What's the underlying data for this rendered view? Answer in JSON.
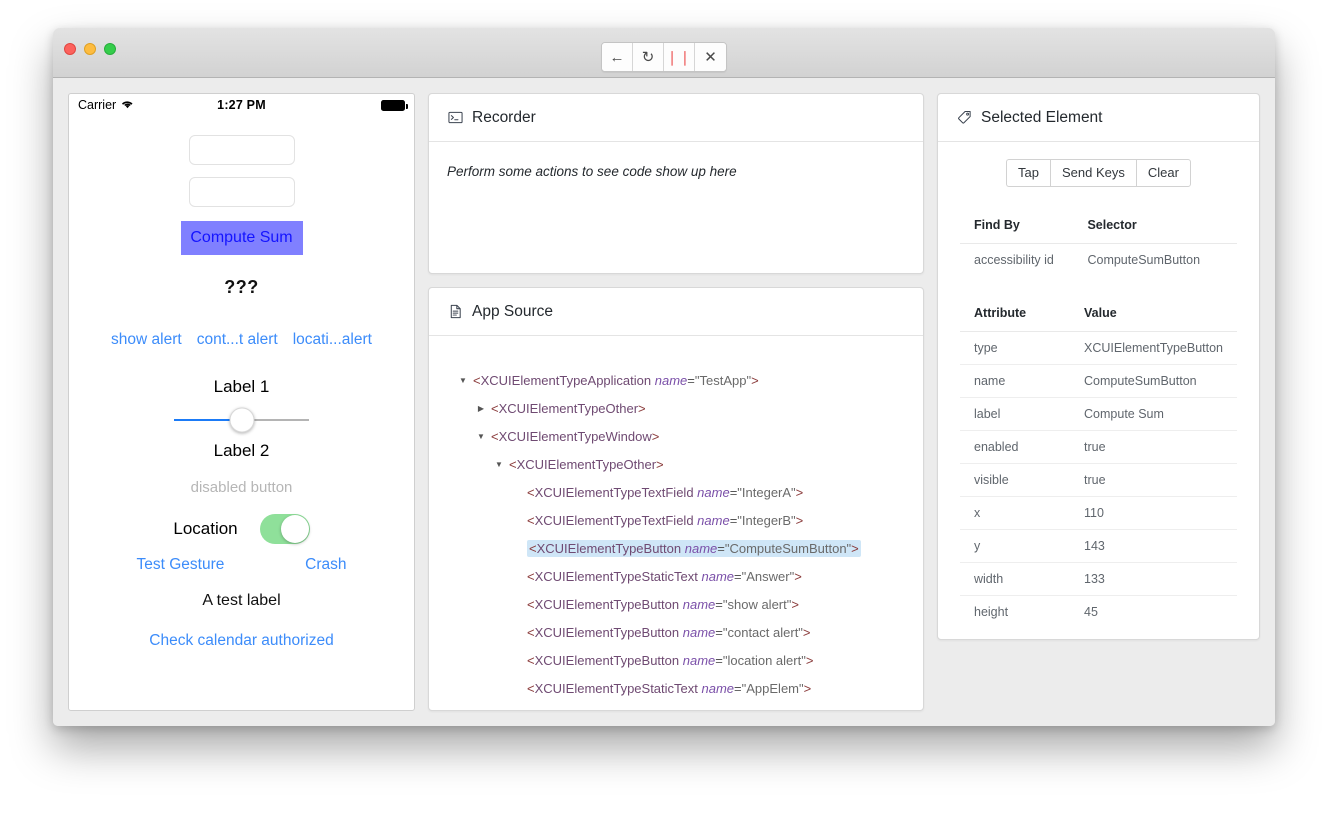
{
  "window": {
    "toolbar_buttons": [
      {
        "name": "back-button",
        "glyph": "←"
      },
      {
        "name": "refresh-button",
        "glyph": "↻"
      },
      {
        "name": "pause-button",
        "glyph": "❘❘"
      },
      {
        "name": "close-session-button",
        "glyph": "✕"
      }
    ]
  },
  "simulator": {
    "status_bar": {
      "carrier": "Carrier",
      "wifi_icon": "wifi-icon",
      "time": "1:27 PM",
      "battery_icon": "battery-icon"
    },
    "field_a_placeholder": "",
    "field_b_placeholder": "",
    "compute_button": "Compute Sum",
    "answer": "???",
    "alerts": [
      "show alert",
      "cont...t alert",
      "locati...alert"
    ],
    "label_1": "Label 1",
    "label_2": "Label 2",
    "slider_value": 50,
    "disabled_button": "disabled button",
    "location_label": "Location",
    "location_toggle_on": true,
    "test_gesture": "Test Gesture",
    "crash": "Crash",
    "test_label": "A test label",
    "calendar_link": "Check calendar authorized"
  },
  "recorder": {
    "title": "Recorder",
    "icon": "terminal-icon",
    "empty_message": "Perform some actions to see code show up here"
  },
  "app_source": {
    "title": "App Source",
    "icon": "document-icon",
    "tree": [
      {
        "indent": 0,
        "twisty": "down",
        "tag": "XCUIElementTypeApplication",
        "attr": "name",
        "value": "TestApp",
        "selected": false
      },
      {
        "indent": 1,
        "twisty": "right",
        "tag": "XCUIElementTypeOther",
        "attr": "",
        "value": "",
        "selected": false
      },
      {
        "indent": 1,
        "twisty": "down",
        "tag": "XCUIElementTypeWindow",
        "attr": "",
        "value": "",
        "selected": false
      },
      {
        "indent": 2,
        "twisty": "down",
        "tag": "XCUIElementTypeOther",
        "attr": "",
        "value": "",
        "selected": false
      },
      {
        "indent": 3,
        "twisty": "none",
        "tag": "XCUIElementTypeTextField",
        "attr": "name",
        "value": "IntegerA",
        "selected": false
      },
      {
        "indent": 3,
        "twisty": "none",
        "tag": "XCUIElementTypeTextField",
        "attr": "name",
        "value": "IntegerB",
        "selected": false
      },
      {
        "indent": 3,
        "twisty": "none",
        "tag": "XCUIElementTypeButton",
        "attr": "name",
        "value": "ComputeSumButton",
        "selected": true
      },
      {
        "indent": 3,
        "twisty": "none",
        "tag": "XCUIElementTypeStaticText",
        "attr": "name",
        "value": "Answer",
        "selected": false
      },
      {
        "indent": 3,
        "twisty": "none",
        "tag": "XCUIElementTypeButton",
        "attr": "name",
        "value": "show alert",
        "selected": false
      },
      {
        "indent": 3,
        "twisty": "none",
        "tag": "XCUIElementTypeButton",
        "attr": "name",
        "value": "contact alert",
        "selected": false
      },
      {
        "indent": 3,
        "twisty": "none",
        "tag": "XCUIElementTypeButton",
        "attr": "name",
        "value": "location alert",
        "selected": false
      },
      {
        "indent": 3,
        "twisty": "none",
        "tag": "XCUIElementTypeStaticText",
        "attr": "name",
        "value": "AppElem",
        "selected": false
      }
    ]
  },
  "selected_element": {
    "title": "Selected Element",
    "icon": "tag-icon",
    "actions": [
      "Tap",
      "Send Keys",
      "Clear"
    ],
    "find_by_table": {
      "headers": [
        "Find By",
        "Selector"
      ],
      "rows": [
        [
          "accessibility id",
          "ComputeSumButton"
        ]
      ]
    },
    "attributes_table": {
      "headers": [
        "Attribute",
        "Value"
      ],
      "rows": [
        [
          "type",
          "XCUIElementTypeButton"
        ],
        [
          "name",
          "ComputeSumButton"
        ],
        [
          "label",
          "Compute Sum"
        ],
        [
          "enabled",
          "true"
        ],
        [
          "visible",
          "true"
        ],
        [
          "x",
          "110"
        ],
        [
          "y",
          "143"
        ],
        [
          "width",
          "133"
        ],
        [
          "height",
          "45"
        ]
      ]
    }
  },
  "colors": {
    "accent_blue": "#3c8cfa",
    "compute_button_bg": "#8080ff",
    "toggle_on": "#8fe09a",
    "selection_highlight": "#cfe6f7",
    "pause_red": "#f28a8a"
  }
}
